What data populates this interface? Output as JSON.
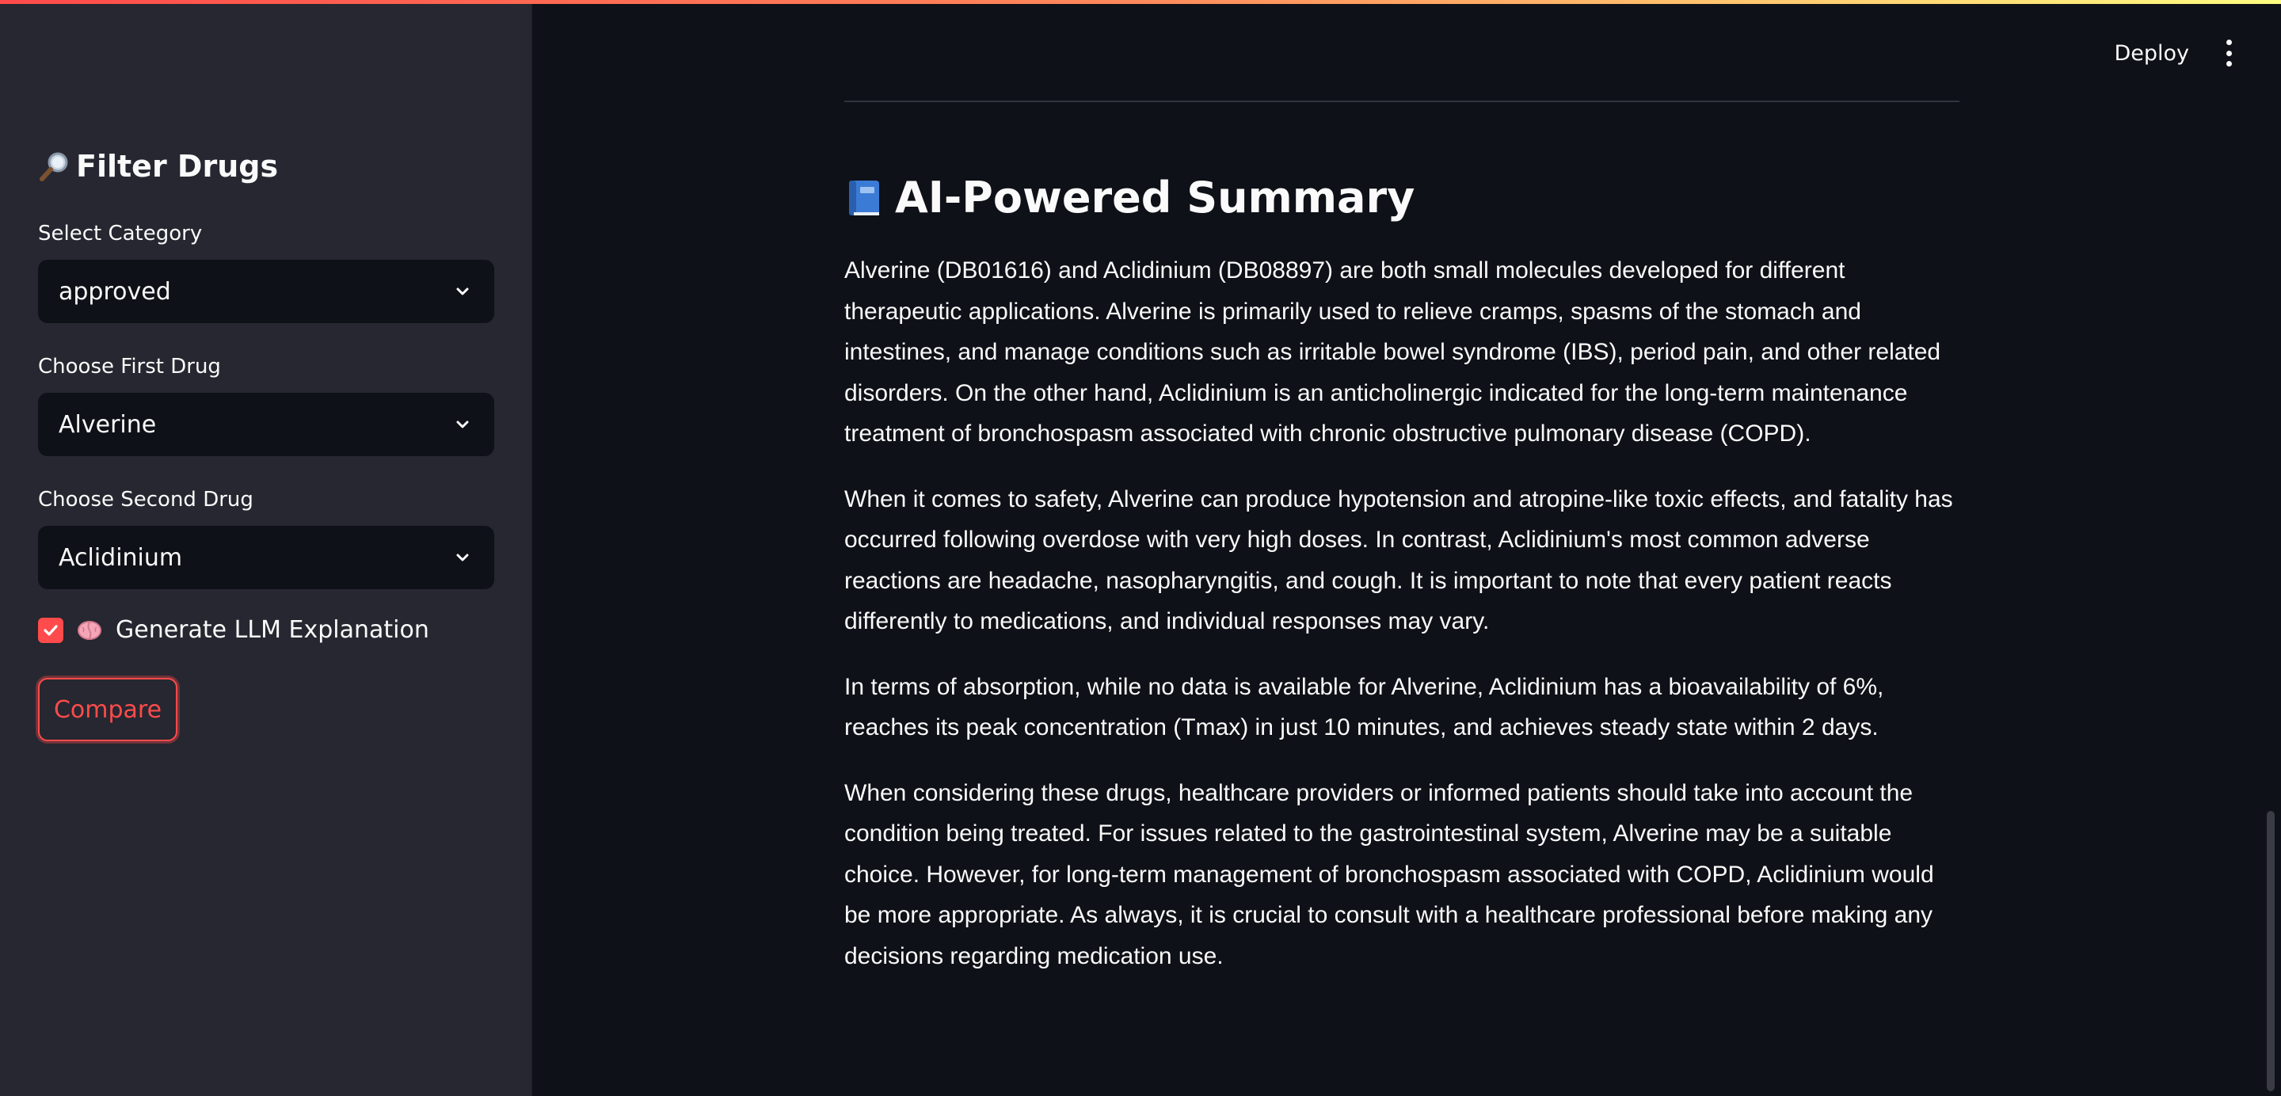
{
  "sidebar": {
    "title": "Filter Drugs",
    "category": {
      "label": "Select Category",
      "value": "approved"
    },
    "first_drug": {
      "label": "Choose First Drug",
      "value": "Alverine"
    },
    "second_drug": {
      "label": "Choose Second Drug",
      "value": "Aclidinium"
    },
    "checkbox": {
      "label": "Generate LLM Explanation",
      "checked": true
    },
    "compare_label": "Compare"
  },
  "header": {
    "deploy_label": "Deploy"
  },
  "main": {
    "heading": "AI-Powered Summary",
    "paragraphs": [
      "Alverine (DB01616) and Aclidinium (DB08897) are both small molecules developed for different therapeutic applications. Alverine is primarily used to relieve cramps, spasms of the stomach and intestines, and manage conditions such as irritable bowel syndrome (IBS), period pain, and other related disorders. On the other hand, Aclidinium is an anticholinergic indicated for the long-term maintenance treatment of bronchospasm associated with chronic obstructive pulmonary disease (COPD).",
      "When it comes to safety, Alverine can produce hypotension and atropine-like toxic effects, and fatality has occurred following overdose with very high doses. In contrast, Aclidinium's most common adverse reactions are headache, nasopharyngitis, and cough. It is important to note that every patient reacts differently to medications, and individual responses may vary.",
      "In terms of absorption, while no data is available for Alverine, Aclidinium has a bioavailability of 6%, reaches its peak concentration (Tmax) in just 10 minutes, and achieves steady state within 2 days.",
      "When considering these drugs, healthcare providers or informed patients should take into account the condition being treated. For issues related to the gastrointestinal system, Alverine may be a suitable choice. However, for long-term management of bronchospasm associated with COPD, Aclidinium would be more appropriate. As always, it is crucial to consult with a healthcare professional before making any decisions regarding medication use."
    ]
  },
  "icons": {
    "title_icon": "magnifier-icon",
    "checkbox_icon": "brain-icon",
    "heading_icon": "book-icon"
  },
  "colors": {
    "accent": "#ff4b4b",
    "sidebar_bg": "#262730",
    "main_bg": "#0e1117"
  }
}
